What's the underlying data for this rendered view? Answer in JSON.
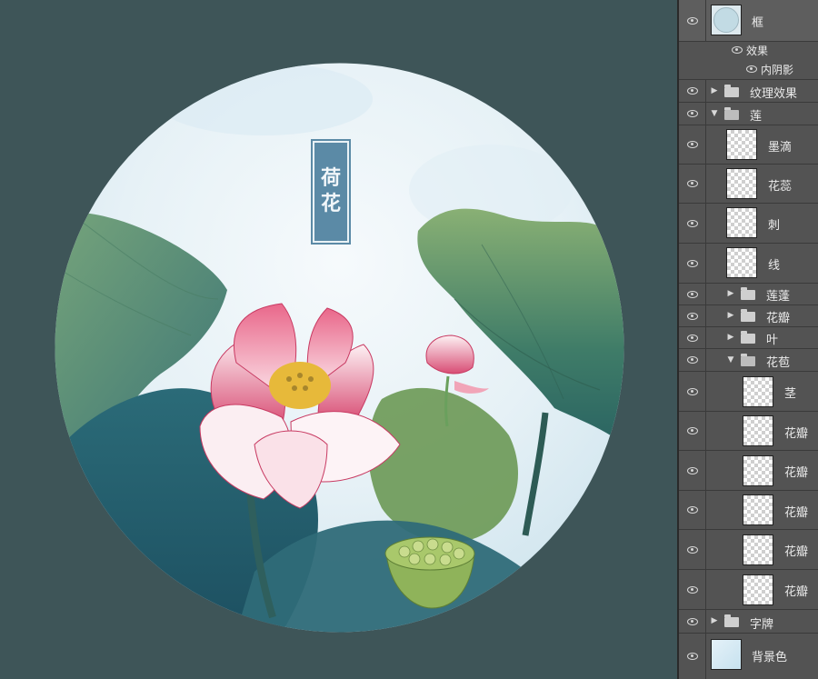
{
  "artwork": {
    "title_chars": [
      "荷",
      "花"
    ]
  },
  "layers": {
    "frame": {
      "name": "框",
      "effects_label": "效果",
      "effect_item": "内阴影"
    },
    "texture_group": "纹理效果",
    "lotus_group": "莲",
    "lotus_layers": [
      "墨滴",
      "花蕊",
      "刺",
      "线"
    ],
    "lotus_subgroups": [
      "莲蓬",
      "花瓣",
      "叶"
    ],
    "bud_group": "花苞",
    "bud_layers": [
      "茎",
      "花瓣",
      "花瓣",
      "花瓣",
      "花瓣",
      "花瓣"
    ],
    "sign_group": "字牌",
    "background": "背景色"
  }
}
